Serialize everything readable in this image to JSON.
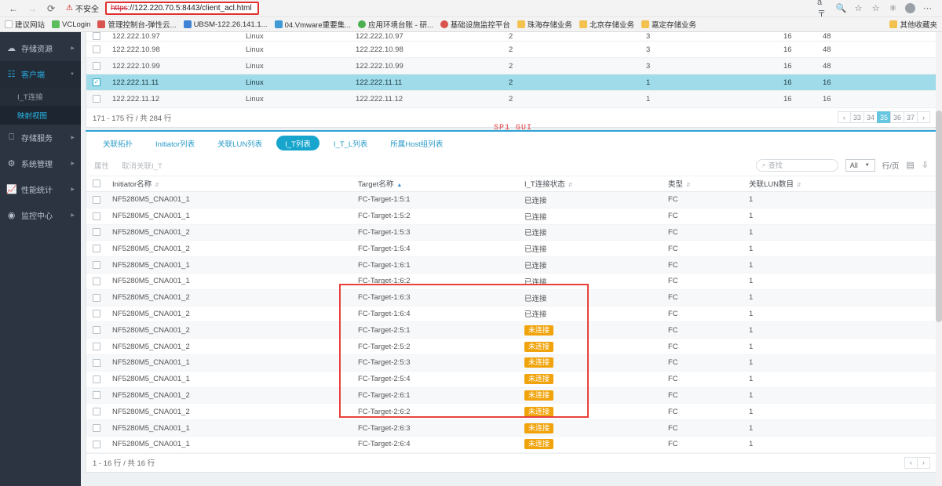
{
  "browser": {
    "back_icon": "arrow-left",
    "forward_icon": "arrow-right",
    "reload_icon": "reload",
    "security_label": "不安全",
    "url_scheme": "https",
    "url_rest": "://122.220.70.5:8443/client_acl.html",
    "right_icons": [
      "translate-icon",
      "zoom-out-icon",
      "favorite-star-icon",
      "collections-icon",
      "browser-essentials-icon",
      "profile-avatar",
      "settings-more-icon"
    ],
    "bookmarks": [
      {
        "label": "建议网站",
        "color": "#ffffff"
      },
      {
        "label": "VCLogin",
        "color": "#5bbd5b"
      },
      {
        "label": "管理控制台-弹性云...",
        "color": "#d9534f"
      },
      {
        "label": "UBSM-122.26.141.1...",
        "color": "#3f82d6"
      },
      {
        "label": "04.Vmware重要集...",
        "color": "#3f9ad6"
      },
      {
        "label": "应用环境台账 - 研...",
        "color": "#4caf50"
      },
      {
        "label": "基础设施监控平台",
        "color": "#d9534f"
      },
      {
        "label": "珠海存储业务",
        "color": "#f2c14e"
      },
      {
        "label": "北京存储业务",
        "color": "#f2c14e"
      },
      {
        "label": "嘉定存储业务",
        "color": "#f2c14e"
      }
    ],
    "other_bookmarks": {
      "label": "其他收藏夹",
      "color": "#f2c14e"
    }
  },
  "sidebar": {
    "items": [
      {
        "label": "存储资源",
        "icon": "cloud-icon",
        "expandable": true,
        "active": false
      },
      {
        "label": "客户端",
        "icon": "client-tree-icon",
        "expandable": true,
        "active": true,
        "children": [
          {
            "label": "I_T连接",
            "active": false
          },
          {
            "label": "映射视图",
            "active": true
          }
        ]
      },
      {
        "label": "存储服务",
        "icon": "service-icon",
        "expandable": true,
        "active": false
      },
      {
        "label": "系统管理",
        "icon": "gear-icon",
        "expandable": true,
        "active": false
      },
      {
        "label": "性能统计",
        "icon": "chart-icon",
        "expandable": true,
        "active": false
      },
      {
        "label": "监控中心",
        "icon": "monitor-icon",
        "expandable": true,
        "active": false
      }
    ]
  },
  "top_table": {
    "cut_row": {
      "name": "122.222.10.97",
      "os": "Linux",
      "ip": "122.222.10.97",
      "c1": "2",
      "c2": "3",
      "c3": "16",
      "c4": "48"
    },
    "rows": [
      {
        "checked": false,
        "selected": false,
        "name": "122.222.10.98",
        "os": "Linux",
        "ip": "122.222.10.98",
        "c1": "2",
        "c2": "3",
        "c3": "16",
        "c4": "48"
      },
      {
        "checked": false,
        "selected": false,
        "name": "122.222.10.99",
        "os": "Linux",
        "ip": "122.222.10.99",
        "c1": "2",
        "c2": "3",
        "c3": "16",
        "c4": "48"
      },
      {
        "checked": true,
        "selected": true,
        "name": "122.222.11.11",
        "os": "Linux",
        "ip": "122.222.11.11",
        "c1": "2",
        "c2": "1",
        "c3": "16",
        "c4": "16"
      },
      {
        "checked": false,
        "selected": false,
        "name": "122.222.11.12",
        "os": "Linux",
        "ip": "122.222.11.12",
        "c1": "2",
        "c2": "1",
        "c3": "16",
        "c4": "16"
      }
    ],
    "summary": "171 - 175 行 / 共 284 行",
    "pages": [
      {
        "label": "‹",
        "active": false
      },
      {
        "label": "33",
        "active": false
      },
      {
        "label": "34",
        "active": false
      },
      {
        "label": "35",
        "active": true
      },
      {
        "label": "36",
        "active": false
      },
      {
        "label": "37",
        "active": false
      },
      {
        "label": "›",
        "active": false
      }
    ]
  },
  "annotation": {
    "sp1_gui": "SP1 GUI"
  },
  "tabs": [
    {
      "label": "关联拓扑",
      "active": false
    },
    {
      "label": "Initiator列表",
      "active": false
    },
    {
      "label": "关联LUN列表",
      "active": false
    },
    {
      "label": "I_T列表",
      "active": true
    },
    {
      "label": "I_T_L列表",
      "active": false
    },
    {
      "label": "所属Host组列表",
      "active": false
    }
  ],
  "toolbar": {
    "properties_label": "属性",
    "unlink_label": "取消关联I_T",
    "search_placeholder": "查找",
    "search_icon": "search-icon",
    "rows_per_page_value": "All",
    "rows_per_page_unit": "行/页",
    "columns_icon": "column-settings-icon",
    "export_icon": "export-icon"
  },
  "bottom_table": {
    "headers": [
      {
        "label": "Initiator名称",
        "sort": "none"
      },
      {
        "label": "Target名称",
        "sort": "none"
      },
      {
        "label": "I_T连接状态",
        "sort": "asc"
      },
      {
        "label": "类型",
        "sort": "none"
      },
      {
        "label": "关联LUN数目",
        "sort": "none"
      }
    ],
    "status_connected": "已连接",
    "status_disconnected": "未连接",
    "rows": [
      {
        "initiator": "NF5280M5_CNA001_1",
        "target": "FC-Target-1:5:1",
        "status": "已连接",
        "connected": true,
        "type": "FC",
        "luns": "1"
      },
      {
        "initiator": "NF5280M5_CNA001_1",
        "target": "FC-Target-1:5:2",
        "status": "已连接",
        "connected": true,
        "type": "FC",
        "luns": "1"
      },
      {
        "initiator": "NF5280M5_CNA001_2",
        "target": "FC-Target-1:5:3",
        "status": "已连接",
        "connected": true,
        "type": "FC",
        "luns": "1"
      },
      {
        "initiator": "NF5280M5_CNA001_2",
        "target": "FC-Target-1:5:4",
        "status": "已连接",
        "connected": true,
        "type": "FC",
        "luns": "1"
      },
      {
        "initiator": "NF5280M5_CNA001_1",
        "target": "FC-Target-1:6:1",
        "status": "已连接",
        "connected": true,
        "type": "FC",
        "luns": "1"
      },
      {
        "initiator": "NF5280M5_CNA001_1",
        "target": "FC-Target-1:6:2",
        "status": "已连接",
        "connected": true,
        "type": "FC",
        "luns": "1"
      },
      {
        "initiator": "NF5280M5_CNA001_2",
        "target": "FC-Target-1:6:3",
        "status": "已连接",
        "connected": true,
        "type": "FC",
        "luns": "1"
      },
      {
        "initiator": "NF5280M5_CNA001_2",
        "target": "FC-Target-1:6:4",
        "status": "已连接",
        "connected": true,
        "type": "FC",
        "luns": "1"
      },
      {
        "initiator": "NF5280M5_CNA001_2",
        "target": "FC-Target-2:5:1",
        "status": "未连接",
        "connected": false,
        "type": "FC",
        "luns": "1"
      },
      {
        "initiator": "NF5280M5_CNA001_2",
        "target": "FC-Target-2:5:2",
        "status": "未连接",
        "connected": false,
        "type": "FC",
        "luns": "1"
      },
      {
        "initiator": "NF5280M5_CNA001_1",
        "target": "FC-Target-2:5:3",
        "status": "未连接",
        "connected": false,
        "type": "FC",
        "luns": "1"
      },
      {
        "initiator": "NF5280M5_CNA001_1",
        "target": "FC-Target-2:5:4",
        "status": "未连接",
        "connected": false,
        "type": "FC",
        "luns": "1"
      },
      {
        "initiator": "NF5280M5_CNA001_2",
        "target": "FC-Target-2:6:1",
        "status": "未连接",
        "connected": false,
        "type": "FC",
        "luns": "1"
      },
      {
        "initiator": "NF5280M5_CNA001_2",
        "target": "FC-Target-2:6:2",
        "status": "未连接",
        "connected": false,
        "type": "FC",
        "luns": "1"
      },
      {
        "initiator": "NF5280M5_CNA001_1",
        "target": "FC-Target-2:6:3",
        "status": "未连接",
        "connected": false,
        "type": "FC",
        "luns": "1"
      },
      {
        "initiator": "NF5280M5_CNA001_1",
        "target": "FC-Target-2:6:4",
        "status": "未连接",
        "connected": false,
        "type": "FC",
        "luns": "1"
      }
    ],
    "summary": "1 - 16 行 / 共 16 行",
    "prev_label": "‹",
    "next_label": "›"
  },
  "colors": {
    "accent": "#17a5cd",
    "sidebar_bg": "#2b3440",
    "selected_row": "#9fdbe8",
    "badge_warning": "#f0a30a",
    "annotation_red": "#e8413c"
  }
}
